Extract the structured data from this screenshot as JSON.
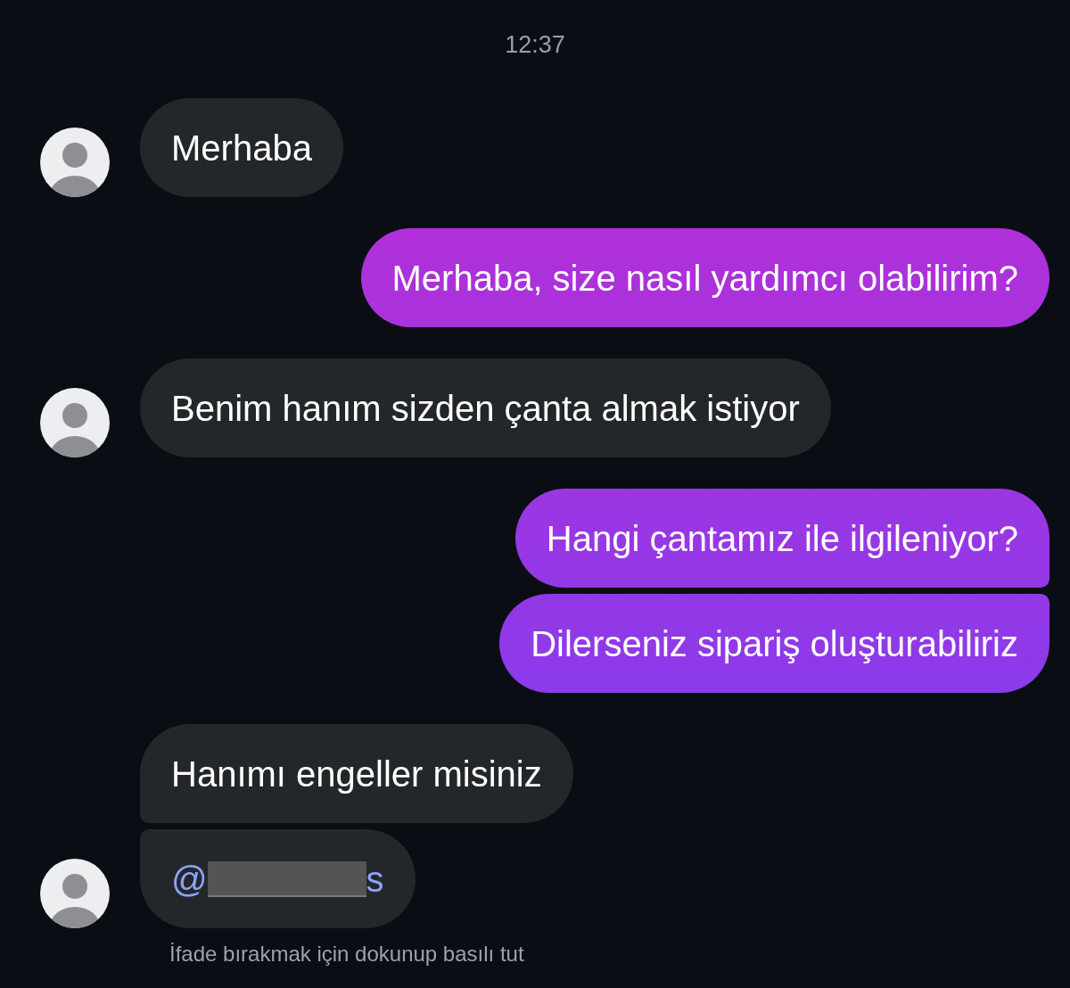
{
  "timestamp": "12:37",
  "messages": [
    {
      "kind": "received",
      "joined_above": false,
      "joined_below": false,
      "avatar": true,
      "text": "Merhaba"
    },
    {
      "kind": "sent",
      "joined_above": false,
      "joined_below": false,
      "avatar": false,
      "text": "Merhaba, size nasıl yardımcı olabilirim?"
    },
    {
      "kind": "received",
      "joined_above": false,
      "joined_below": false,
      "avatar": true,
      "text": "Benim hanım sizden çanta almak istiyor"
    },
    {
      "kind": "sent",
      "joined_above": false,
      "joined_below": true,
      "avatar": false,
      "text": "Hangi çantamız ile ilgileniyor?"
    },
    {
      "kind": "sent",
      "joined_above": true,
      "joined_below": false,
      "avatar": false,
      "text": "Dilerseniz sipariş oluşturabiliriz"
    },
    {
      "kind": "received",
      "joined_above": false,
      "joined_below": true,
      "avatar": false,
      "text": "Hanımı engeller misiniz"
    },
    {
      "kind": "mention",
      "joined_above": true,
      "joined_below": false,
      "avatar": true,
      "prefix": "@",
      "suffix": "s",
      "redacted": true
    }
  ],
  "hint": "İfade bırakmak için dokunup basılı tut"
}
